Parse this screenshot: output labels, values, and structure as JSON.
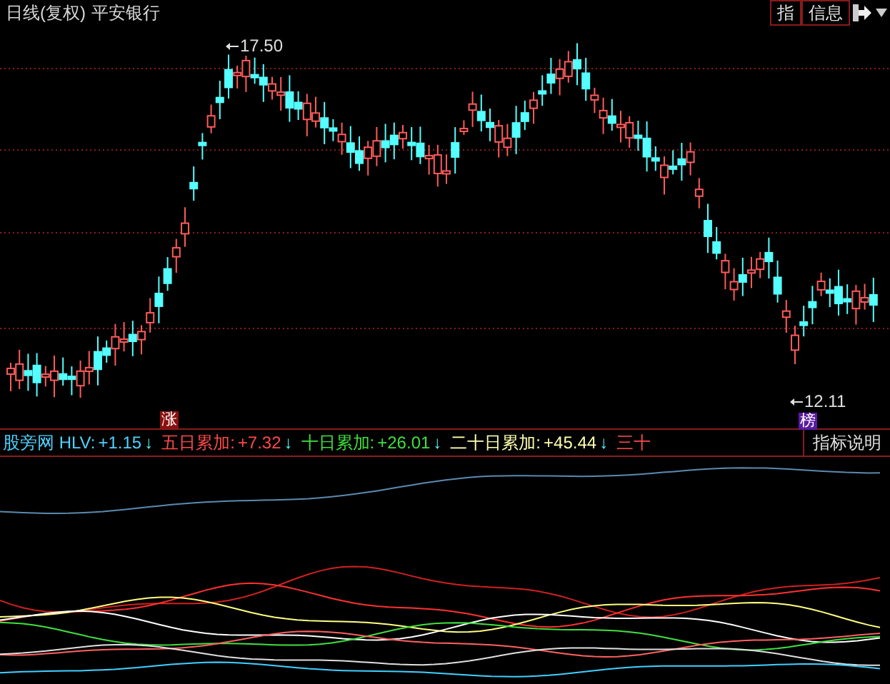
{
  "header": {
    "period": "日线(复权)",
    "stock": "平安银行"
  },
  "toolbar": [
    {
      "label": "指"
    },
    {
      "label": "信息"
    }
  ],
  "price_marks": [
    {
      "kind": "high",
      "label": "17.50"
    },
    {
      "kind": "low",
      "label": "12.11"
    }
  ],
  "badges": [
    {
      "kind": "rise",
      "label": "涨"
    },
    {
      "kind": "rank",
      "label": "榜"
    }
  ],
  "indicator": {
    "items": [
      {
        "kind": "hlv",
        "label": "股旁网 HLV:",
        "value": "+1.15",
        "arrow": "↓"
      },
      {
        "kind": "sum5",
        "label": "五日累加:",
        "value": "+7.32",
        "arrow": "↓"
      },
      {
        "kind": "sum10",
        "label": "十日累加:",
        "value": "+26.01",
        "arrow": "↓"
      },
      {
        "kind": "sum20",
        "label": "二十日累加:",
        "value": "+45.44",
        "arrow": "↓"
      },
      {
        "kind": "sum30",
        "label": "三十"
      }
    ],
    "button": "指标说明"
  }
}
